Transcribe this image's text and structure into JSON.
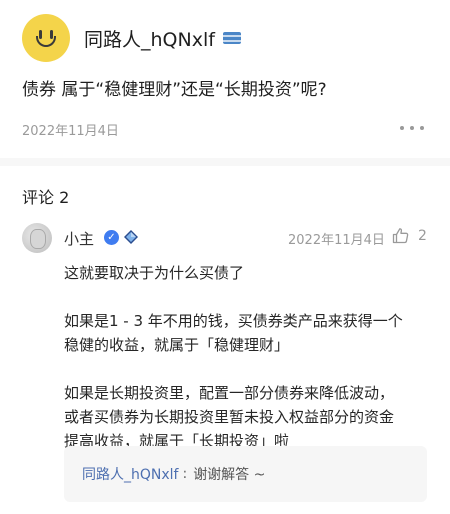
{
  "post": {
    "author": "同路人_hQNxlf",
    "title": "债券 属于“稳健理财”还是“长期投资”呢?",
    "date": "2022年11月4日"
  },
  "comments_section": {
    "title": "评论 2"
  },
  "comment": {
    "author": "小主",
    "date": "2022年11月4日",
    "likes": "2",
    "lines": [
      "这就要取决于为什么买债了",
      "如果是1 - 3 年不用的钱，买债券类产品来获得一个",
      "稳健的收益，就属于「稳健理财」",
      "如果是长期投资里，配置一部分债券来降低波动，",
      "或者买债券为长期投资里暂未投入权益部分的资金",
      "提高收益，就属于「长期投资」啦"
    ]
  },
  "reply": {
    "author": "同路人_hQNxlf",
    "separator": ":",
    "text": "谢谢解答 ~"
  },
  "icons": {
    "post_avatar": "smiley-face-avatar",
    "author_badge": "stripe-badge-icon",
    "more": "more-dots-icon",
    "verified": "verified-check-icon",
    "level": "diamond-icon",
    "like": "thumb-up-icon"
  },
  "colors": {
    "accent_blue": "#3f7cf0",
    "reply_author": "#4d6fb0",
    "muted": "#9a9a9a"
  }
}
